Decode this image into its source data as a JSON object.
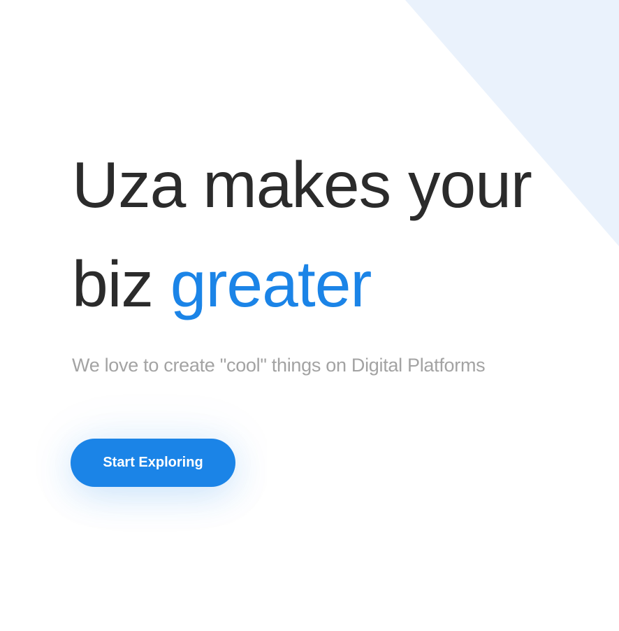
{
  "hero": {
    "title_line1": "Uza makes your",
    "title_line2_plain": "biz ",
    "title_line2_accent": "greater",
    "subtitle": "We love to create \"cool\" things on Digital Platforms",
    "cta_label": "Start Exploring"
  },
  "colors": {
    "accent": "#1b84e7",
    "heading": "#2b2b2b",
    "subtitle": "#a3a3a3",
    "background_shape": "#eaf2fc"
  }
}
